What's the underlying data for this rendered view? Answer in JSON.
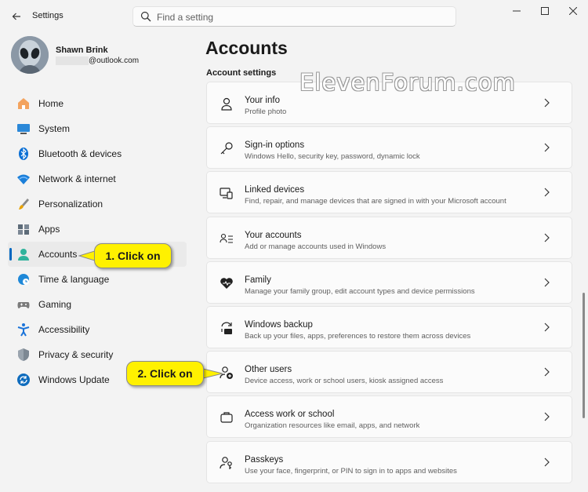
{
  "window": {
    "title": "Settings",
    "minimize": "—",
    "maximize": "☐",
    "close": "✕"
  },
  "search": {
    "placeholder": "Find a setting"
  },
  "user": {
    "name": "Shawn Brink",
    "email_suffix": "@outlook.com"
  },
  "nav": {
    "items": [
      {
        "label": "Home",
        "icon": "home-icon"
      },
      {
        "label": "System",
        "icon": "system-icon"
      },
      {
        "label": "Bluetooth & devices",
        "icon": "bluetooth-icon"
      },
      {
        "label": "Network & internet",
        "icon": "wifi-icon"
      },
      {
        "label": "Personalization",
        "icon": "brush-icon"
      },
      {
        "label": "Apps",
        "icon": "apps-icon"
      },
      {
        "label": "Accounts",
        "icon": "person-icon",
        "active": true
      },
      {
        "label": "Time & language",
        "icon": "globe-clock-icon"
      },
      {
        "label": "Gaming",
        "icon": "gamepad-icon"
      },
      {
        "label": "Accessibility",
        "icon": "accessibility-icon"
      },
      {
        "label": "Privacy & security",
        "icon": "shield-icon"
      },
      {
        "label": "Windows Update",
        "icon": "update-icon"
      }
    ]
  },
  "main": {
    "title": "Accounts",
    "section_title": "Account settings",
    "watermark": "ElevenForum.com",
    "cards": [
      {
        "title": "Your info",
        "subtitle": "Profile photo",
        "icon": "person-outline-icon"
      },
      {
        "title": "Sign-in options",
        "subtitle": "Windows Hello, security key, password, dynamic lock",
        "icon": "key-icon"
      },
      {
        "title": "Linked devices",
        "subtitle": "Find, repair, and manage devices that are signed in with your Microsoft account",
        "icon": "linked-devices-icon"
      },
      {
        "title": "Your accounts",
        "subtitle": "Add or manage accounts used in Windows",
        "icon": "accounts-list-icon"
      },
      {
        "title": "Family",
        "subtitle": "Manage your family group, edit account types and device permissions",
        "icon": "heart-icon"
      },
      {
        "title": "Windows backup",
        "subtitle": "Back up your files, apps, preferences to restore them across devices",
        "icon": "backup-icon"
      },
      {
        "title": "Other users",
        "subtitle": "Device access, work or school users, kiosk assigned access",
        "icon": "person-add-icon"
      },
      {
        "title": "Access work or school",
        "subtitle": "Organization resources like email, apps, and network",
        "icon": "briefcase-icon"
      },
      {
        "title": "Passkeys",
        "subtitle": "Use your face, fingerprint, or PIN to sign in to apps and websites",
        "icon": "passkey-icon"
      }
    ]
  },
  "callouts": {
    "first": "1. Click on",
    "second": "2. Click on"
  },
  "colors": {
    "accent": "#0067c0",
    "callout": "#fff100",
    "background": "#f3f3f3"
  }
}
